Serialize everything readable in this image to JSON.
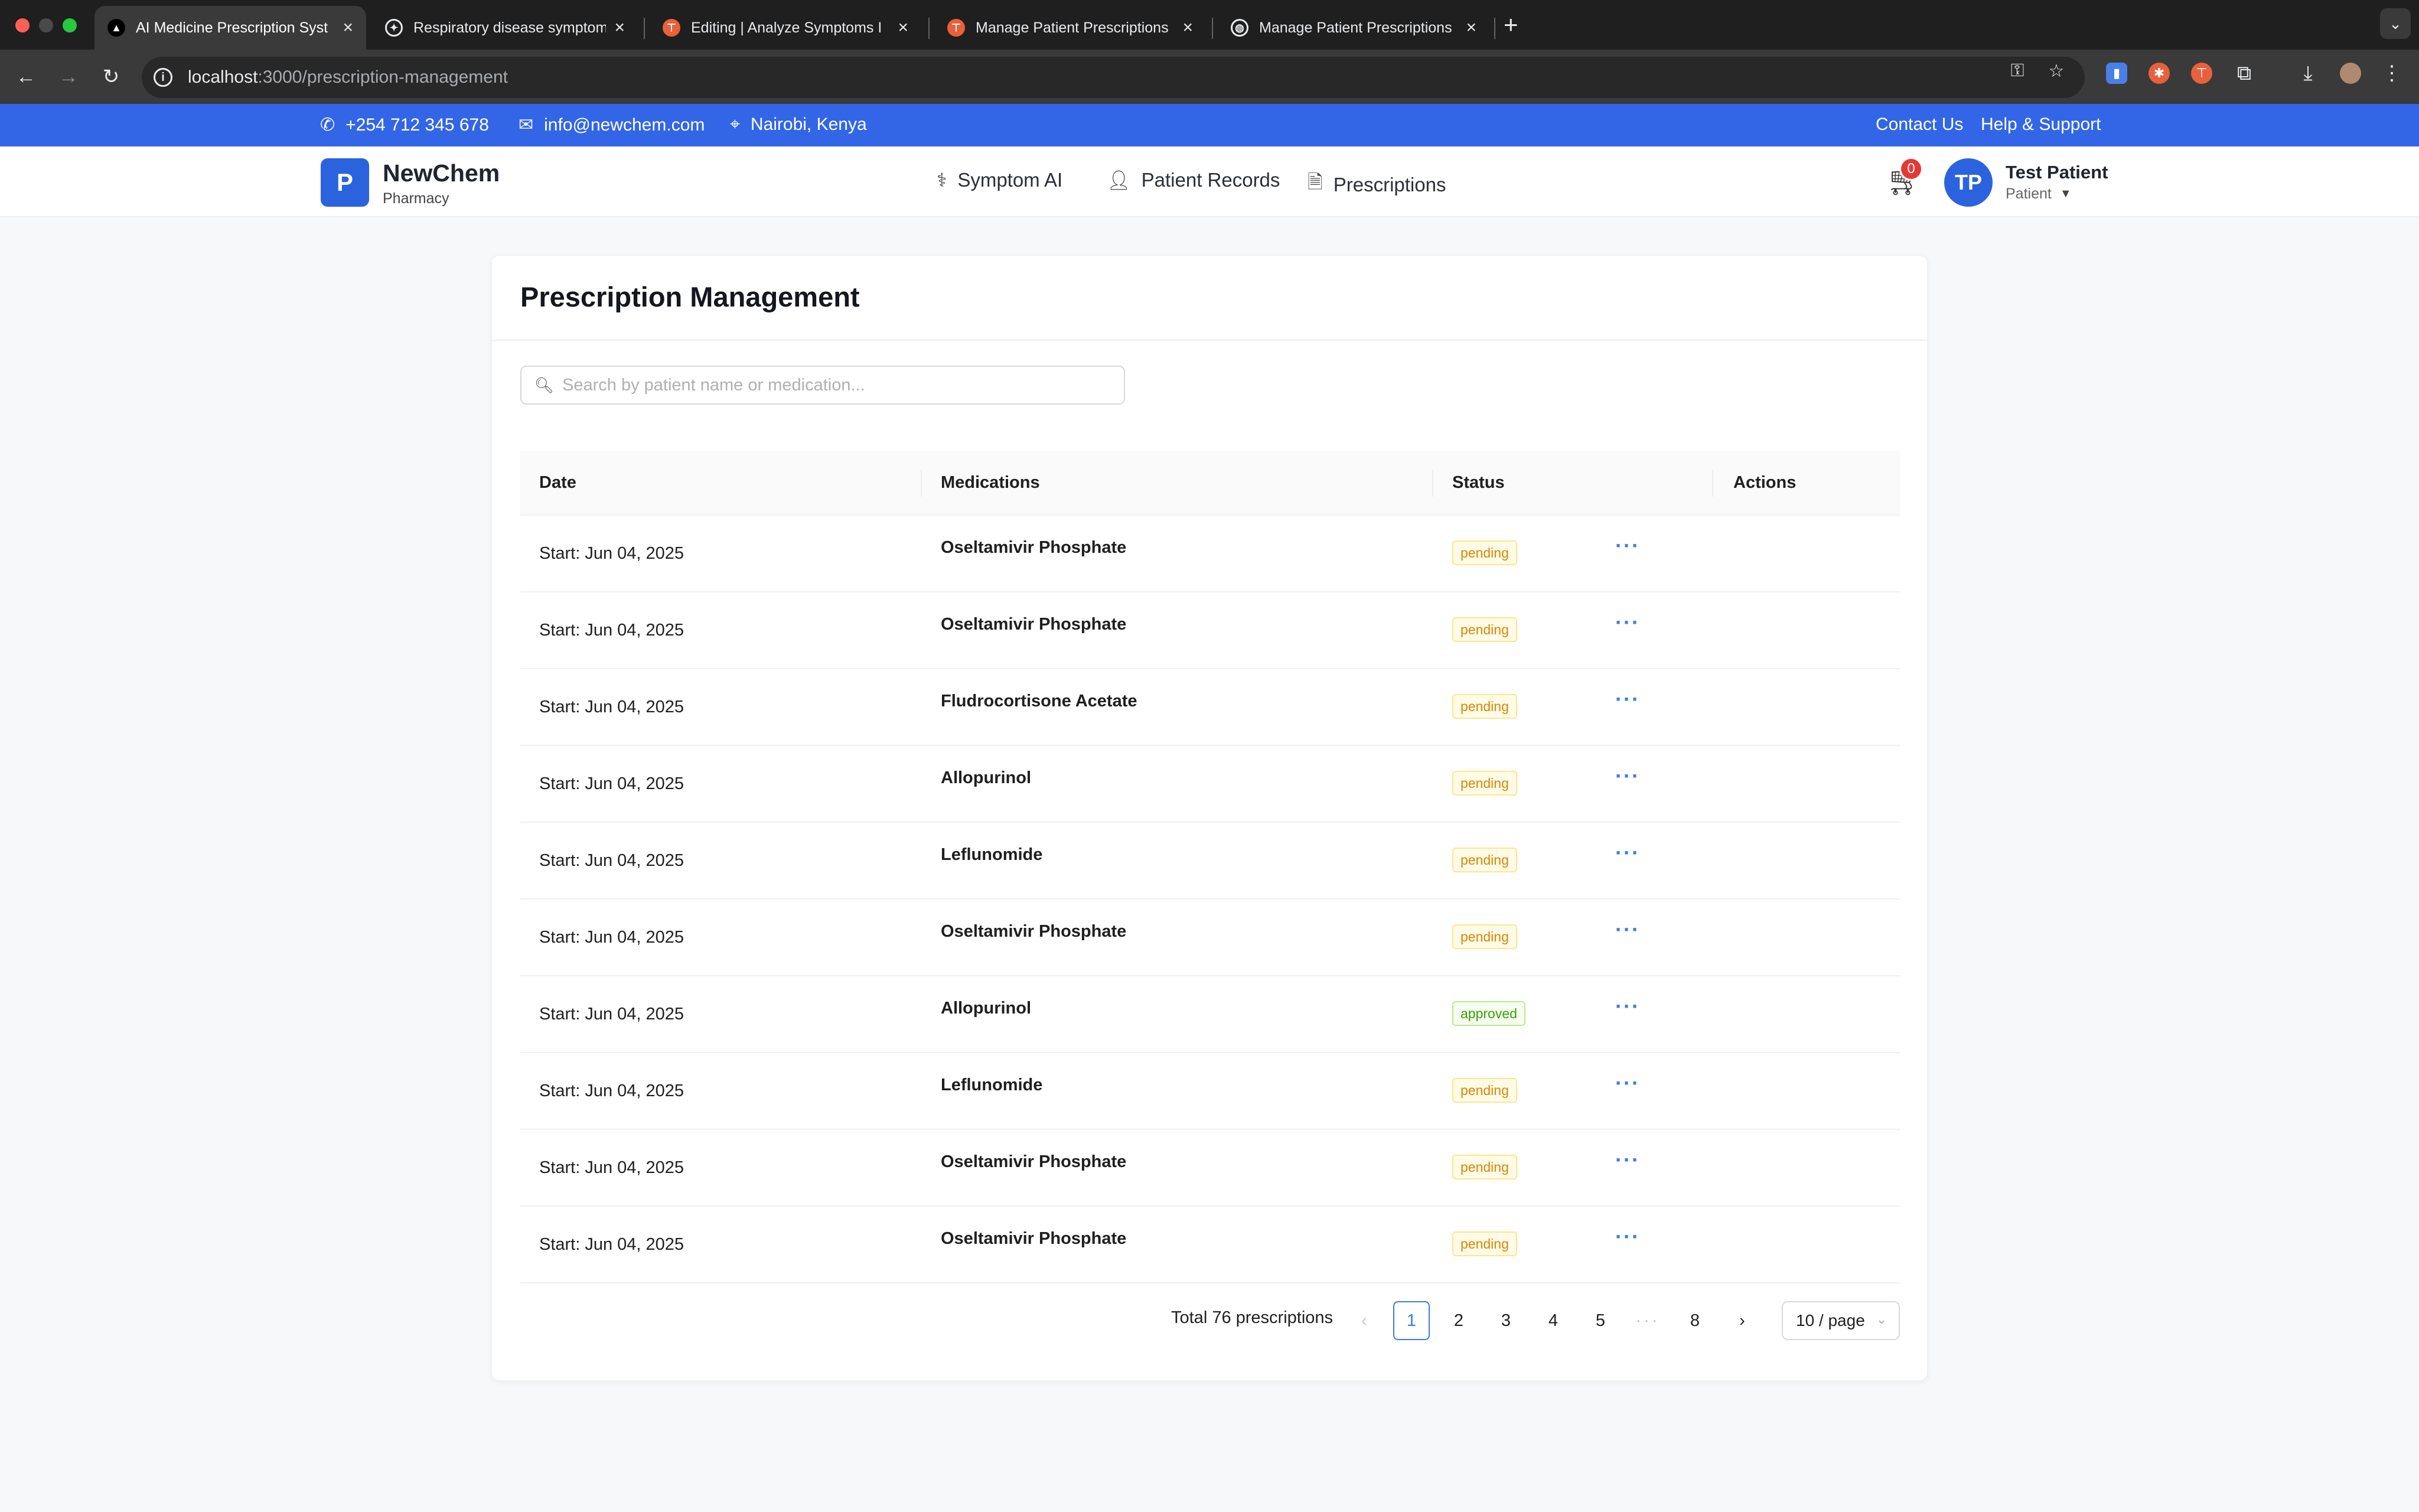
{
  "browser": {
    "tabs": [
      {
        "title": "AI Medicine Prescription Syst",
        "active": true
      },
      {
        "title": "Respiratory disease symptom",
        "active": false
      },
      {
        "title": "Editing | Analyze Symptoms I",
        "active": false
      },
      {
        "title": "Manage Patient Prescriptions",
        "active": false
      },
      {
        "title": "Manage Patient Prescriptions",
        "active": false
      }
    ],
    "new_tab": "+",
    "url_host": "localhost",
    "url_path": ":3000/prescription-management"
  },
  "contact_bar": {
    "phone": "+254 712 345 678",
    "email": "info@newchem.com",
    "location": "Nairobi, Kenya",
    "contact_us": "Contact Us",
    "help": "Help & Support"
  },
  "header": {
    "logo_letter": "P",
    "brand": "NewChem",
    "brand_sub": "Pharmacy",
    "nav": [
      "Symptom AI",
      "Patient Records",
      "Prescriptions"
    ],
    "cart_count": "0",
    "avatar_initials": "TP",
    "user_name": "Test Patient",
    "user_role": "Patient"
  },
  "page": {
    "title": "Prescription Management",
    "search_placeholder": "Search by patient name or medication...",
    "columns": [
      "Date",
      "Medications",
      "Status",
      "Actions"
    ],
    "rows": [
      {
        "date": "Start: Jun 04, 2025",
        "medication": "Oseltamivir Phosphate",
        "status": "pending"
      },
      {
        "date": "Start: Jun 04, 2025",
        "medication": "Oseltamivir Phosphate",
        "status": "pending"
      },
      {
        "date": "Start: Jun 04, 2025",
        "medication": "Fludrocortisone Acetate",
        "status": "pending"
      },
      {
        "date": "Start: Jun 04, 2025",
        "medication": "Allopurinol",
        "status": "pending"
      },
      {
        "date": "Start: Jun 04, 2025",
        "medication": "Leflunomide",
        "status": "pending"
      },
      {
        "date": "Start: Jun 04, 2025",
        "medication": "Oseltamivir Phosphate",
        "status": "pending"
      },
      {
        "date": "Start: Jun 04, 2025",
        "medication": "Allopurinol",
        "status": "approved"
      },
      {
        "date": "Start: Jun 04, 2025",
        "medication": "Leflunomide",
        "status": "pending"
      },
      {
        "date": "Start: Jun 04, 2025",
        "medication": "Oseltamivir Phosphate",
        "status": "pending"
      },
      {
        "date": "Start: Jun 04, 2025",
        "medication": "Oseltamivir Phosphate",
        "status": "pending"
      }
    ],
    "actions_label": "···",
    "pagination": {
      "total": "Total 76 prescriptions",
      "prev": "‹",
      "pages": [
        "1",
        "2",
        "3",
        "4",
        "5"
      ],
      "ellipsis": "···",
      "last": "8",
      "next": "›",
      "current": "1",
      "page_size": "10 / page"
    }
  },
  "colors": {
    "brand_blue": "#3366e6",
    "pending": "#d48806",
    "approved": "#389e0d"
  }
}
